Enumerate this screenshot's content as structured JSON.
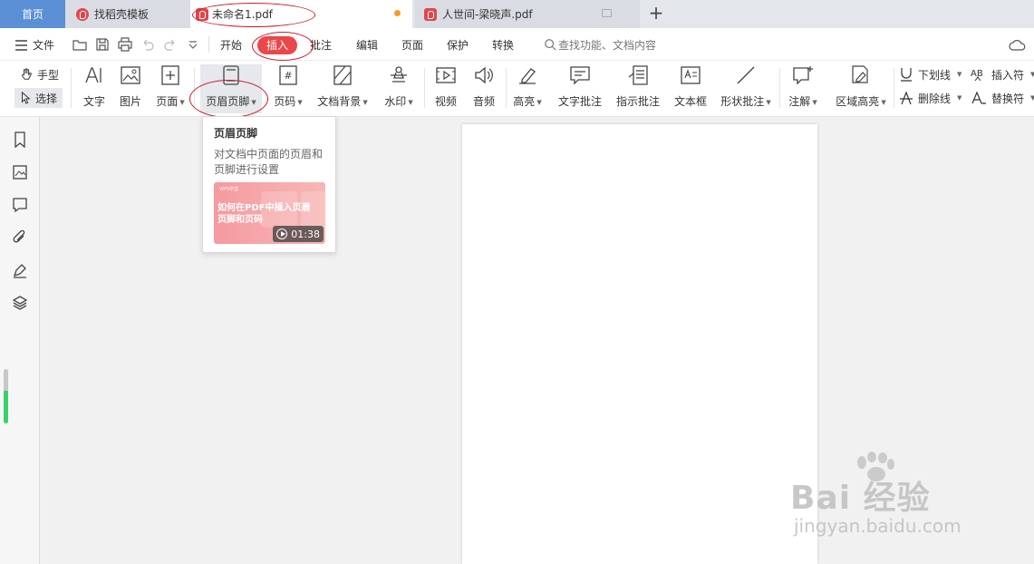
{
  "tabs": {
    "home": "首页",
    "templates": "找稻壳模板",
    "doc1": "未命名1.pdf",
    "doc2": "人世间-梁晓声.pdf",
    "add": "+"
  },
  "menu": {
    "file": "文件",
    "items": [
      "开始",
      "插入",
      "批注",
      "编辑",
      "页面",
      "保护",
      "转换"
    ],
    "active": "插入",
    "search_placeholder": "查找功能、文档内容"
  },
  "ribbon": {
    "hand": "手型",
    "select": "选择",
    "buttons": [
      "文字",
      "图片",
      "页面",
      "页眉页脚",
      "页码",
      "文档背景",
      "水印",
      "视频",
      "音频",
      "高亮",
      "文字批注",
      "指示批注",
      "文本框",
      "形状批注",
      "注解",
      "区域高亮"
    ],
    "right": {
      "underline": "下划线",
      "strike": "删除线",
      "insert_char": "插入符",
      "replace_char": "替换符"
    }
  },
  "popup": {
    "title": "页眉页脚",
    "description": "对文档中页面的页眉和页脚进行设置",
    "thumb_brand": "WPS学堂",
    "thumb_title": "如何在PDF中插入页眉页脚和页码",
    "duration": "01:38"
  },
  "watermark": {
    "brand": "Bai 经验",
    "url": "jingyan.baidu.com"
  },
  "colors": {
    "accent": "#e9474a",
    "home_tab": "#5b8fd6",
    "annotation": "#c81e2a",
    "scroll_green": "#3bd06a"
  }
}
